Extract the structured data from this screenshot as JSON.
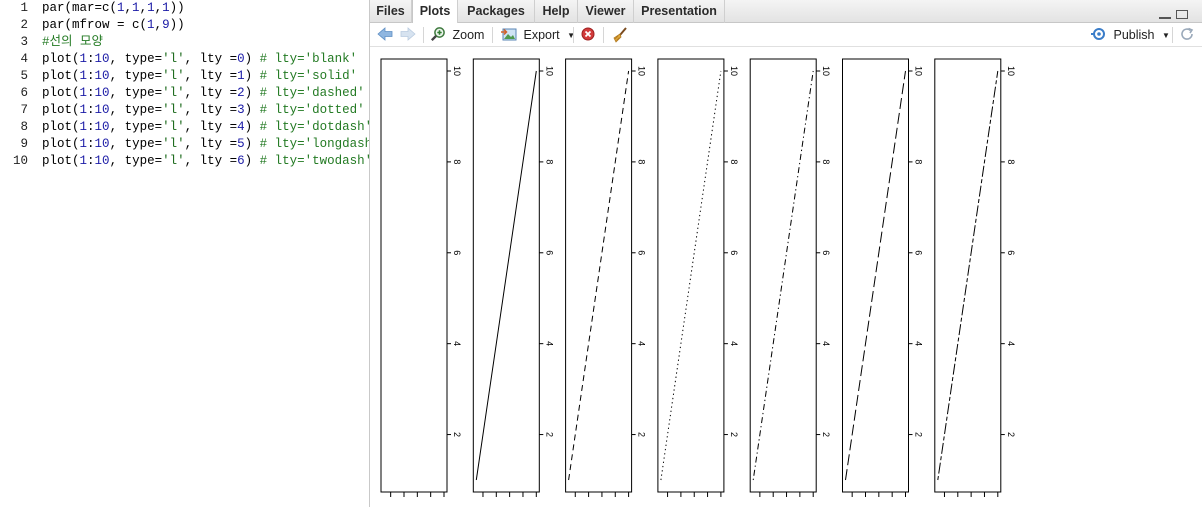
{
  "editor": {
    "lines": [
      {
        "n": "1",
        "tokens": [
          [
            "t",
            "par(mar=c("
          ],
          [
            "n",
            "1"
          ],
          [
            "t",
            ","
          ],
          [
            "n",
            "1"
          ],
          [
            "t",
            ","
          ],
          [
            "n",
            "1"
          ],
          [
            "t",
            ","
          ],
          [
            "n",
            "1"
          ],
          [
            "t",
            "))"
          ]
        ]
      },
      {
        "n": "2",
        "tokens": [
          [
            "t",
            "par(mfrow = c("
          ],
          [
            "n",
            "1"
          ],
          [
            "t",
            ","
          ],
          [
            "n",
            "9"
          ],
          [
            "t",
            "))"
          ]
        ]
      },
      {
        "n": "3",
        "tokens": [
          [
            "c",
            "#선의 모양"
          ]
        ]
      },
      {
        "n": "4",
        "tokens": [
          [
            "t",
            "plot("
          ],
          [
            "n",
            "1"
          ],
          [
            "t",
            ":"
          ],
          [
            "n",
            "10"
          ],
          [
            "t",
            ", type="
          ],
          [
            "s",
            "'l'"
          ],
          [
            "t",
            ", lty ="
          ],
          [
            "n",
            "0"
          ],
          [
            "t",
            ") "
          ],
          [
            "c",
            "# lty='blank'"
          ]
        ]
      },
      {
        "n": "5",
        "tokens": [
          [
            "t",
            "plot("
          ],
          [
            "n",
            "1"
          ],
          [
            "t",
            ":"
          ],
          [
            "n",
            "10"
          ],
          [
            "t",
            ", type="
          ],
          [
            "s",
            "'l'"
          ],
          [
            "t",
            ", lty ="
          ],
          [
            "n",
            "1"
          ],
          [
            "t",
            ") "
          ],
          [
            "c",
            "# lty='solid'"
          ]
        ]
      },
      {
        "n": "6",
        "tokens": [
          [
            "t",
            "plot("
          ],
          [
            "n",
            "1"
          ],
          [
            "t",
            ":"
          ],
          [
            "n",
            "10"
          ],
          [
            "t",
            ", type="
          ],
          [
            "s",
            "'l'"
          ],
          [
            "t",
            ", lty ="
          ],
          [
            "n",
            "2"
          ],
          [
            "t",
            ") "
          ],
          [
            "c",
            "# lty='dashed'"
          ]
        ]
      },
      {
        "n": "7",
        "tokens": [
          [
            "t",
            "plot("
          ],
          [
            "n",
            "1"
          ],
          [
            "t",
            ":"
          ],
          [
            "n",
            "10"
          ],
          [
            "t",
            ", type="
          ],
          [
            "s",
            "'l'"
          ],
          [
            "t",
            ", lty ="
          ],
          [
            "n",
            "3"
          ],
          [
            "t",
            ") "
          ],
          [
            "c",
            "# lty='dotted'"
          ]
        ]
      },
      {
        "n": "8",
        "tokens": [
          [
            "t",
            "plot("
          ],
          [
            "n",
            "1"
          ],
          [
            "t",
            ":"
          ],
          [
            "n",
            "10"
          ],
          [
            "t",
            ", type="
          ],
          [
            "s",
            "'l'"
          ],
          [
            "t",
            ", lty ="
          ],
          [
            "n",
            "4"
          ],
          [
            "t",
            ") "
          ],
          [
            "c",
            "# lty='dotdash'"
          ]
        ]
      },
      {
        "n": "9",
        "tokens": [
          [
            "t",
            "plot("
          ],
          [
            "n",
            "1"
          ],
          [
            "t",
            ":"
          ],
          [
            "n",
            "10"
          ],
          [
            "t",
            ", type="
          ],
          [
            "s",
            "'l'"
          ],
          [
            "t",
            ", lty ="
          ],
          [
            "n",
            "5"
          ],
          [
            "t",
            ") "
          ],
          [
            "c",
            "# lty='longdash'"
          ]
        ]
      },
      {
        "n": "10",
        "tokens": [
          [
            "t",
            "plot("
          ],
          [
            "n",
            "1"
          ],
          [
            "t",
            ":"
          ],
          [
            "n",
            "10"
          ],
          [
            "t",
            ", type="
          ],
          [
            "s",
            "'l'"
          ],
          [
            "t",
            ", lty ="
          ],
          [
            "n",
            "6"
          ],
          [
            "t",
            ") "
          ],
          [
            "c",
            "# lty='twodash'"
          ]
        ]
      }
    ]
  },
  "tabs": [
    {
      "label": "Files",
      "active": false
    },
    {
      "label": "Plots",
      "active": true
    },
    {
      "label": "Packages",
      "active": false
    },
    {
      "label": "Help",
      "active": false
    },
    {
      "label": "Viewer",
      "active": false
    },
    {
      "label": "Presentation",
      "active": false
    }
  ],
  "toolbar": {
    "zoom_label": "Zoom",
    "export_label": "Export",
    "publish_label": "Publish",
    "icons": [
      "back-arrow-icon",
      "forward-arrow-icon",
      "zoom-icon",
      "export-icon",
      "remove-plot-icon",
      "broom-icon",
      "publish-icon",
      "refresh-icon"
    ]
  },
  "colors": {
    "accent": "#3a7dc9",
    "remove": "#d23b3b",
    "broom": "#c78a2b"
  },
  "chart_data": {
    "type": "line",
    "x": [
      1,
      2,
      3,
      4,
      5,
      6,
      7,
      8,
      9,
      10
    ],
    "series": [
      {
        "lty": "blank",
        "values": [
          1,
          2,
          3,
          4,
          5,
          6,
          7,
          8,
          9,
          10
        ]
      },
      {
        "lty": "solid",
        "values": [
          1,
          2,
          3,
          4,
          5,
          6,
          7,
          8,
          9,
          10
        ]
      },
      {
        "lty": "dashed",
        "values": [
          1,
          2,
          3,
          4,
          5,
          6,
          7,
          8,
          9,
          10
        ]
      },
      {
        "lty": "dotted",
        "values": [
          1,
          2,
          3,
          4,
          5,
          6,
          7,
          8,
          9,
          10
        ]
      },
      {
        "lty": "dotdash",
        "values": [
          1,
          2,
          3,
          4,
          5,
          6,
          7,
          8,
          9,
          10
        ]
      },
      {
        "lty": "longdash",
        "values": [
          1,
          2,
          3,
          4,
          5,
          6,
          7,
          8,
          9,
          10
        ]
      },
      {
        "lty": "twodash",
        "values": [
          1,
          2,
          3,
          4,
          5,
          6,
          7,
          8,
          9,
          10
        ]
      }
    ],
    "y_ticks": [
      "2",
      "4",
      "6",
      "8",
      "10"
    ],
    "ylim": [
      1,
      10
    ],
    "xlim": [
      1,
      10
    ],
    "grid": false
  }
}
